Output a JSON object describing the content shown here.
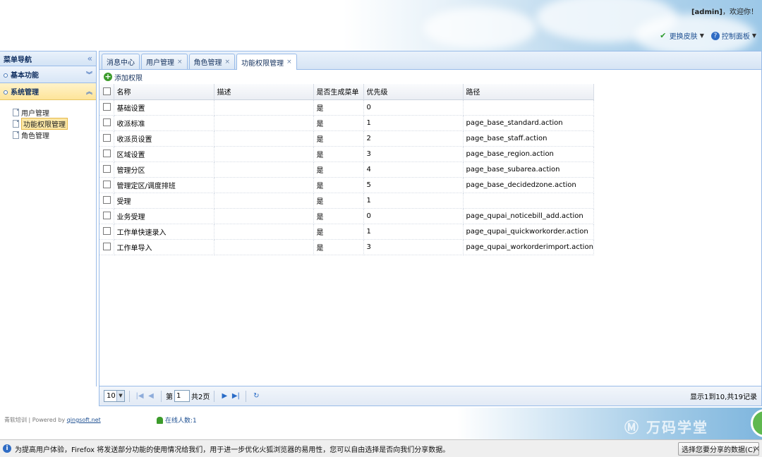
{
  "header": {
    "user": "[admin]",
    "welcome": "，欢迎你！",
    "change_skin": "更换皮肤",
    "control_panel": "控制面板"
  },
  "nav": {
    "title": "菜单导航",
    "sections": [
      {
        "label": "基本功能",
        "state": "collapsed"
      },
      {
        "label": "系统管理",
        "state": "expanded"
      }
    ],
    "items": [
      "用户管理",
      "功能权限管理",
      "角色管理"
    ],
    "selected": "功能权限管理"
  },
  "tabs": [
    {
      "label": "消息中心",
      "closable": false
    },
    {
      "label": "用户管理",
      "closable": true
    },
    {
      "label": "角色管理",
      "closable": true
    },
    {
      "label": "功能权限管理",
      "closable": true,
      "active": true
    }
  ],
  "toolbar": {
    "add_label": "添加权限"
  },
  "grid": {
    "columns": [
      "名称",
      "描述",
      "是否生成菜单",
      "优先级",
      "路径"
    ],
    "rows": [
      [
        "基础设置",
        "",
        "是",
        "0",
        ""
      ],
      [
        "收派标准",
        "",
        "是",
        "1",
        "page_base_standard.action"
      ],
      [
        "收派员设置",
        "",
        "是",
        "2",
        "page_base_staff.action"
      ],
      [
        "区域设置",
        "",
        "是",
        "3",
        "page_base_region.action"
      ],
      [
        "管理分区",
        "",
        "是",
        "4",
        "page_base_subarea.action"
      ],
      [
        "管理定区/调度排班",
        "",
        "是",
        "5",
        "page_base_decidedzone.action"
      ],
      [
        "受理",
        "",
        "是",
        "1",
        ""
      ],
      [
        "业务受理",
        "",
        "是",
        "0",
        "page_qupai_noticebill_add.action"
      ],
      [
        "工作单快速录入",
        "",
        "是",
        "1",
        "page_qupai_quickworkorder.action"
      ],
      [
        "工作单导入",
        "",
        "是",
        "3",
        "page_qupai_workorderimport.action"
      ]
    ]
  },
  "pager": {
    "page_size": "10",
    "page_prefix": "第",
    "current_page": "1",
    "total_pages": "共2页",
    "info": "显示1到10,共19记录"
  },
  "footer": {
    "powered_prefix": "青软培训 | Powered by ",
    "powered_link": "qingsoft.net",
    "online_users": "在线人数:1"
  },
  "notification": {
    "message": "为提高用户体验，Firefox 将发送部分功能的使用情况给我们，用于进一步优化火狐浏览器的易用性，您可以自由选择是否向我们分享数据。",
    "button": "选择您要分享的数据(C)"
  }
}
